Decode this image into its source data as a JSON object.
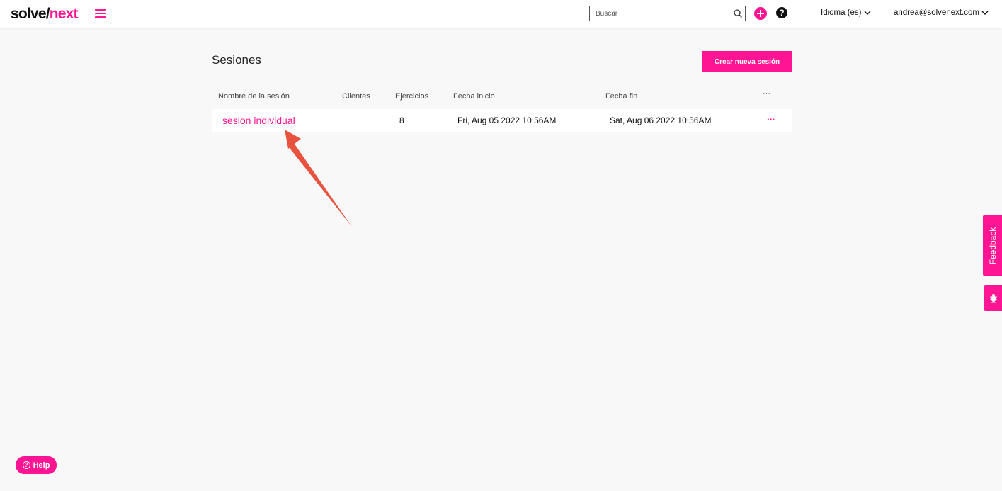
{
  "header": {
    "logo_main": "solve/",
    "logo_accent": "next",
    "search_placeholder": "Buscar",
    "help_glyph": "?",
    "language_label": "Idioma (es)",
    "user_email": "andrea@solvenext.com"
  },
  "main": {
    "title": "Sesiones",
    "create_button": "Crear nueva sesión",
    "columns": {
      "name": "Nombre de la sesión",
      "clients": "Clientes",
      "exercises": "Ejercicios",
      "start": "Fecha inicio",
      "end": "Fecha fin",
      "actions": "···"
    },
    "rows": [
      {
        "name": "sesion individual",
        "clients": "",
        "exercises": "8",
        "start": "Fri, Aug 05 2022 10:56AM",
        "end": "Sat, Aug 06 2022 10:56AM",
        "actions": "···"
      }
    ]
  },
  "side": {
    "feedback_label": "Feedback",
    "help_label": "Help",
    "help_glyph": "?"
  },
  "colors": {
    "accent": "#ff1493",
    "annotation_arrow": "#e8533f"
  },
  "icons": [
    "menu-icon",
    "search-icon",
    "plus-icon",
    "question-icon",
    "chevron-down-icon",
    "bug-icon",
    "help-circle-icon"
  ]
}
